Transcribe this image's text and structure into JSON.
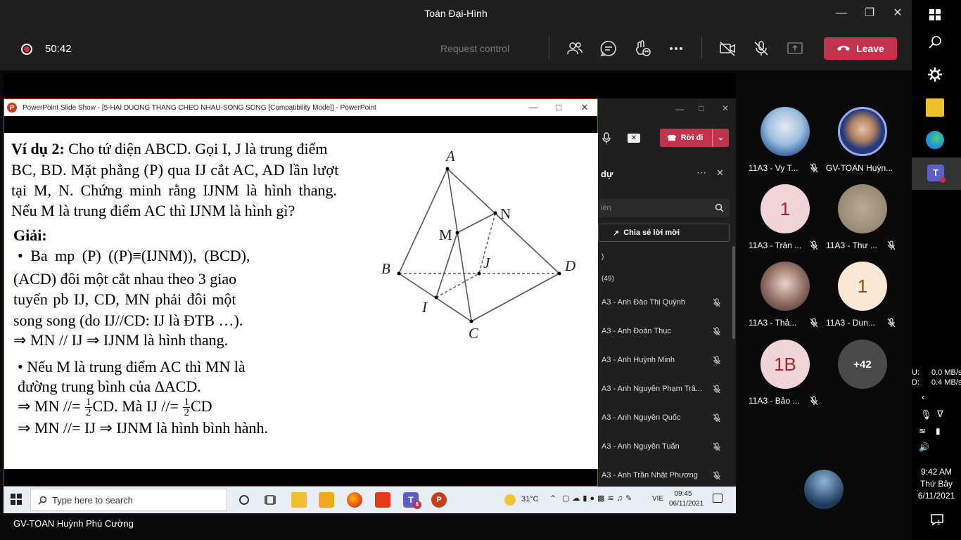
{
  "window": {
    "title": "Toán Đại-Hình"
  },
  "call": {
    "timer": "50:42",
    "request_control": "Request control",
    "leave_label": "Leave"
  },
  "ppt": {
    "title": "PowerPoint Slide Show - [5-HAI DUONG THANG CHEO NHAU-SONG SONG [Compatibility Mode]] - PowerPoint",
    "icon_letter": "P"
  },
  "slide": {
    "example_label": "Ví dụ 2:",
    "p1_line1": " Cho tứ diện ABCD. Gọi I, J là trung điểm",
    "p1_line2": "BC, BD. Mặt phẳng (P) qua IJ cắt AC, AD lần lượt",
    "p1_line3": "tại M, N. Chứng minh rằng IJNM là hình thang.",
    "p1_line4": "Nếu M là trung điểm AC thì IJNM là hình gì?",
    "solution_label": "Giải:",
    "b1_line1": "• Ba mp (P) ((P)≡(IJNM)), (BCD),",
    "b1_line2": "(ACD) đôi một cắt nhau theo 3 giao",
    "b1_line3": "tuyến pb IJ, CD, MN phải đôi một",
    "b1_line4": "song song (do IJ//CD: IJ là ĐTB …).",
    "b1_line5": "⇒ MN // IJ ⇒ IJNM là hình thang.",
    "b2_line1": "• Nếu M là trung điểm AC thì MN là",
    "b2_line2": "đường trung bình của ΔACD.",
    "b2_line3a": "⇒ MN //= ",
    "b2_line3b": "CD. Mà IJ //= ",
    "b2_line3c": "CD",
    "frac_num": "1",
    "frac_den": "2",
    "b2_line4": "⇒ MN //= IJ ⇒ IJNM là hình bình hành.",
    "labels": {
      "A": "A",
      "B": "B",
      "C": "C",
      "D": "D",
      "I": "I",
      "J": "J",
      "M": "M",
      "N": "N"
    }
  },
  "meeting_panel": {
    "leave_label": "Rời đi",
    "heading": "dự",
    "search_placeholder": "iên",
    "share_invite": "Chia sẻ lời mời",
    "section1": ")",
    "section2": "(49)",
    "participants": [
      "A3 - Anh Đào Thị Quỳnh",
      "A3 - Anh Đoàn Thục",
      "A3 - Anh Huỳnh Minh",
      "A3 - Anh Nguyễn Phạm Trâ...",
      "A3 - Anh Nguyễn Quốc",
      "A3 - Anh Nguyễn Tuấn",
      "A3 - Anh Trần Nhật Phương"
    ]
  },
  "taskbar": {
    "search_placeholder": "Type here to search",
    "temperature": "31°C",
    "language": "VIE",
    "time": "09:45",
    "date": "06/11/2021",
    "teams_badge": "6"
  },
  "presenter_name": "GV-TOAN Huỳnh Phú Cường",
  "gallery": [
    {
      "name": "11A3 - Vy T...",
      "initial": ""
    },
    {
      "name": "GV-TOAN Huỳn...",
      "initial": ""
    },
    {
      "name": "11A3 - Trân ...",
      "initial": "1"
    },
    {
      "name": "11A3 - Thư ...",
      "initial": ""
    },
    {
      "name": "11A3 - Thả...",
      "initial": ""
    },
    {
      "name": "11A3 - Dun...",
      "initial": "1"
    },
    {
      "name": "11A3 - Bảo ...",
      "initial": "1B"
    },
    {
      "name": "",
      "initial": "+42"
    }
  ],
  "system": {
    "net_up_label": "U:",
    "net_up": "0.0 MB/s",
    "net_down_label": "D:",
    "net_down": "0.4 MB/s",
    "time": "9:42 AM",
    "day": "Thứ Bảy",
    "date": "6/11/2021",
    "notif_count": "1"
  },
  "colors": {
    "leave": "#c4314b",
    "accent_ppt": "#c43e1c",
    "avatar_pink": "#f1d4d8",
    "avatar_peach": "#fce7d2",
    "avatar_dark": "#4a4a4a"
  }
}
